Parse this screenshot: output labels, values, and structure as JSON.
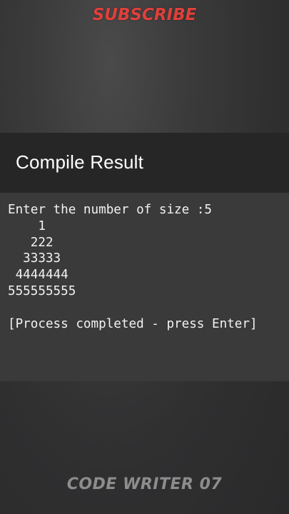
{
  "overlay": {
    "subscribe_text": "SUBSCRIBE",
    "subscribe_color": "#e0403a",
    "watermark": "CODE WRITER 07"
  },
  "header": {
    "title": "Compile Result"
  },
  "console": {
    "lines": [
      "Enter the number of size :5",
      "    1",
      "   222",
      "  33333",
      " 4444444",
      "555555555",
      "",
      "[Process completed - press Enter]"
    ]
  },
  "colors": {
    "header_bg": "#262627",
    "console_bg": "#3a3a3b",
    "text": "#f2f2f2"
  }
}
